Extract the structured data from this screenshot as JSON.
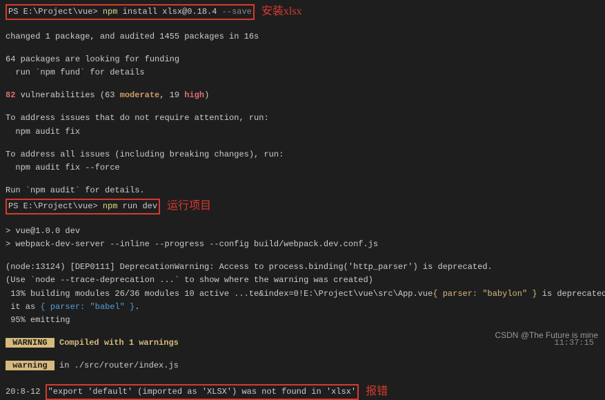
{
  "term": {
    "line1_prompt": "PS E:\\Project\\vue> ",
    "line1_cmd1": "npm ",
    "line1_cmd2": "install xlsx@0.18.4 ",
    "line1_cmd3": "--save",
    "anno1": "安装xlsx",
    "line2": "changed 1 package, and audited 1455 packages in 16s",
    "line3": "64 packages are looking for funding",
    "line4": "  run `npm fund` for details",
    "line5_a": "82",
    "line5_b": " vulnerabilities (63 ",
    "line5_c": "moderate",
    "line5_d": ", 19 ",
    "line5_e": "high",
    "line5_f": ")",
    "line6": "To address issues that do not require attention, run:",
    "line7": "  npm audit fix",
    "line8": "To address all issues (including breaking changes), run:",
    "line9": "  npm audit fix --force",
    "line10": "Run `npm audit` for details.",
    "line11_prompt": "PS E:\\Project\\vue> ",
    "line11_cmd1": "npm ",
    "line11_cmd2": "run dev",
    "anno2": "运行项目",
    "line12": "> vue@1.0.0 dev",
    "line13": "> webpack-dev-server --inline --progress --config build/webpack.dev.conf.js",
    "line14": "(node:13124) [DEP0111] DeprecationWarning: Access to process.binding('http_parser') is deprecated.",
    "line15": "(Use `node --trace-deprecation ...` to show where the warning was created)",
    "line16_a": " 13% building modules 26/36 modules 10 active ...te&index=0!E:\\Project\\vue\\src\\App.vue",
    "line16_b": "{ parser: ",
    "line16_c": "\"babylon\"",
    "line16_d": " }",
    "line16_e": " is deprecated; we now treat",
    "line17_a": " it as ",
    "line17_b": "{ parser: ",
    "line17_c": "\"babel\"",
    "line17_d": " }",
    "line17_e": ".",
    "line18": " 95% emitting",
    "warn_label": " WARNING ",
    "warn_text": " Compiled with 1 warnings",
    "warn_time": "11:37:15",
    "warn2_label": " warning ",
    "warn2_text": " in ./src/router/index.js",
    "err_pos": "20:8-12 ",
    "err_msg": "\"export 'default' (imported as 'XLSX') was not found in 'xlsx'",
    "anno3": "报错"
  },
  "watermark": "CSDN @The Future is mine"
}
